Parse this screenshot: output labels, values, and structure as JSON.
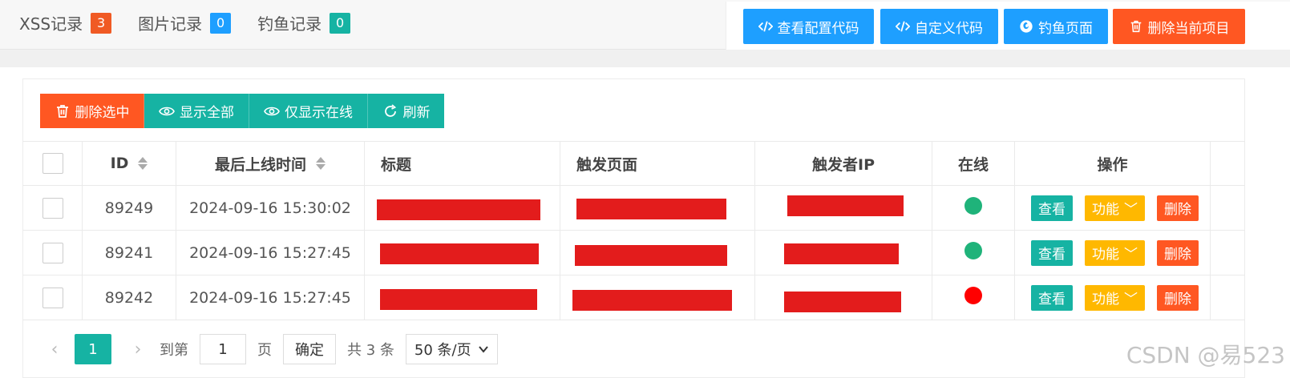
{
  "header": {
    "tabs": [
      {
        "label": "XSS记录",
        "count": "3",
        "badge_color": "#f05a24"
      },
      {
        "label": "图片记录",
        "count": "0",
        "badge_color": "#1e9fff"
      },
      {
        "label": "钓鱼记录",
        "count": "0",
        "badge_color": "#16b3a3"
      }
    ],
    "actions": [
      {
        "label": "查看配置代码",
        "icon": "code-icon",
        "color": "#1e9fff"
      },
      {
        "label": "自定义代码",
        "icon": "code-icon",
        "color": "#1e9fff"
      },
      {
        "label": "钓鱼页面",
        "icon": "firefox-icon",
        "color": "#1e9fff"
      },
      {
        "label": "删除当前项目",
        "icon": "trash-icon",
        "color": "#ff5722"
      }
    ]
  },
  "toolbar": {
    "delete_selected": "删除选中",
    "show_all": "显示全部",
    "show_online": "仅显示在线",
    "refresh": "刷新"
  },
  "table": {
    "columns": [
      "ID",
      "最后上线时间",
      "标题",
      "触发页面",
      "触发者IP",
      "在线",
      "操作"
    ],
    "rows": [
      {
        "id": "89249",
        "time": "2024-09-16 15:30:02",
        "online_color": "#1fb37a"
      },
      {
        "id": "89241",
        "time": "2024-09-16 15:27:45",
        "online_color": "#1fb37a"
      },
      {
        "id": "89242",
        "time": "2024-09-16 15:27:45",
        "online_color": "#ff0000"
      }
    ],
    "row_actions": {
      "view": "查看",
      "func": "功能",
      "delete": "删除"
    }
  },
  "pagination": {
    "current_page": "1",
    "goto_label": "到第",
    "goto_value": "1",
    "page_unit": "页",
    "confirm": "确定",
    "total": "共 3 条",
    "page_size": "50 条/页"
  },
  "watermark": "CSDN @易523"
}
